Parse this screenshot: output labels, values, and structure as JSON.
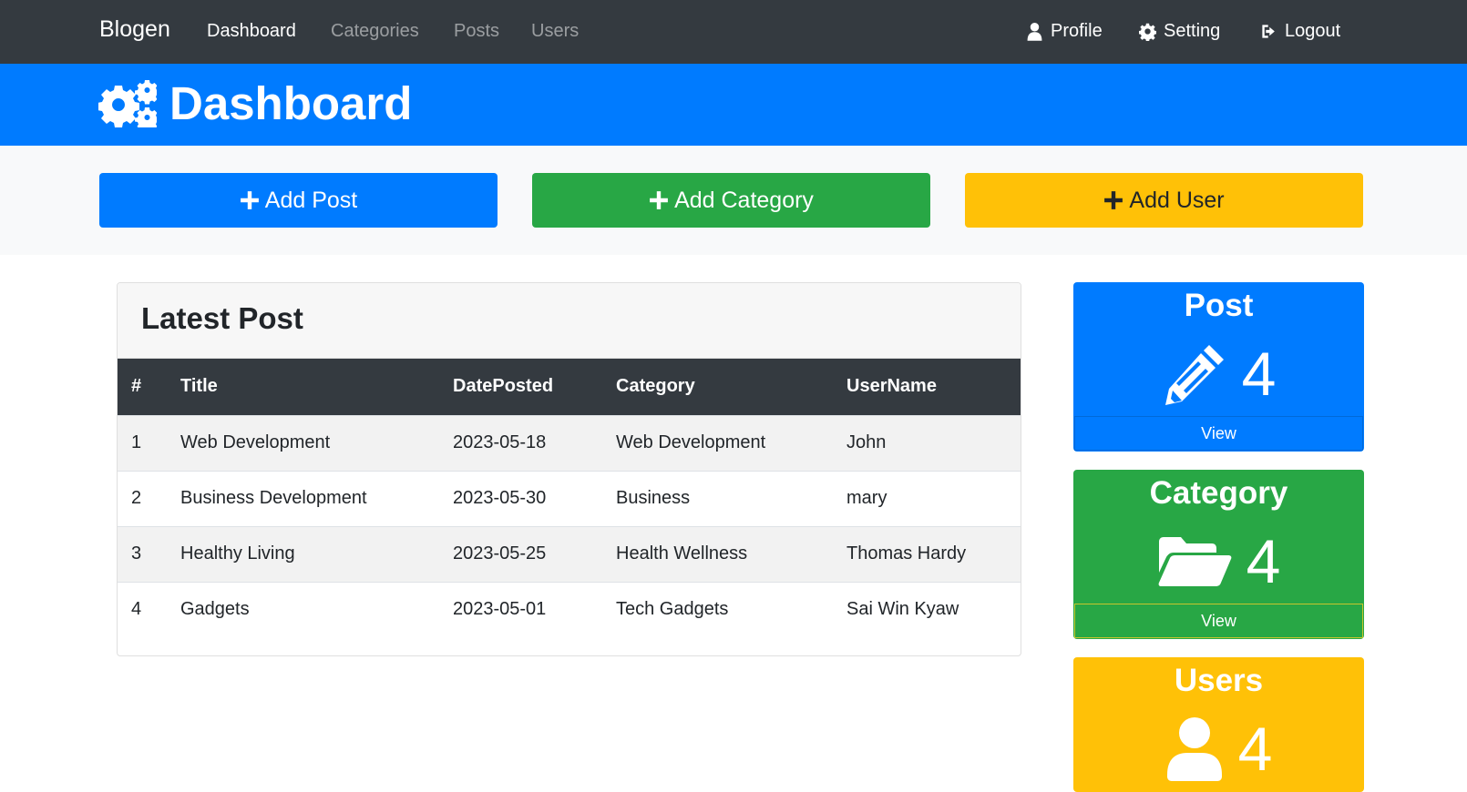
{
  "navbar": {
    "brand": "Blogen",
    "links": [
      "Dashboard",
      "Categories",
      "Posts",
      "Users"
    ],
    "right": [
      {
        "label": "Profile",
        "icon": "user-icon"
      },
      {
        "label": "Setting",
        "icon": "gear-icon"
      },
      {
        "label": "Logout",
        "icon": "logout-icon"
      }
    ]
  },
  "header": {
    "title": "Dashboard",
    "icon": "gears-icon"
  },
  "actions": [
    {
      "label": "Add Post",
      "color": "#007bff"
    },
    {
      "label": "Add Category",
      "color": "#28a745"
    },
    {
      "label": "Add User",
      "color": "#ffc107"
    }
  ],
  "latest_post": {
    "title": "Latest Post",
    "columns": [
      "#",
      "Title",
      "DatePosted",
      "Category",
      "UserName"
    ],
    "rows": [
      [
        "1",
        "Web Development",
        "2023-05-18",
        "Web Development",
        "John"
      ],
      [
        "2",
        "Business Development",
        "2023-05-30",
        "Business",
        "mary"
      ],
      [
        "3",
        "Healthy Living",
        "2023-05-25",
        "Health Wellness",
        "Thomas Hardy"
      ],
      [
        "4",
        "Gadgets",
        "2023-05-01",
        "Tech Gadgets",
        "Sai Win Kyaw"
      ]
    ]
  },
  "stats": [
    {
      "title": "Post",
      "count": "4",
      "view": "View",
      "icon": "pencil-icon"
    },
    {
      "title": "Category",
      "count": "4",
      "view": "View",
      "icon": "folder-open-icon"
    },
    {
      "title": "Users",
      "count": "4",
      "icon": "user-icon"
    }
  ]
}
